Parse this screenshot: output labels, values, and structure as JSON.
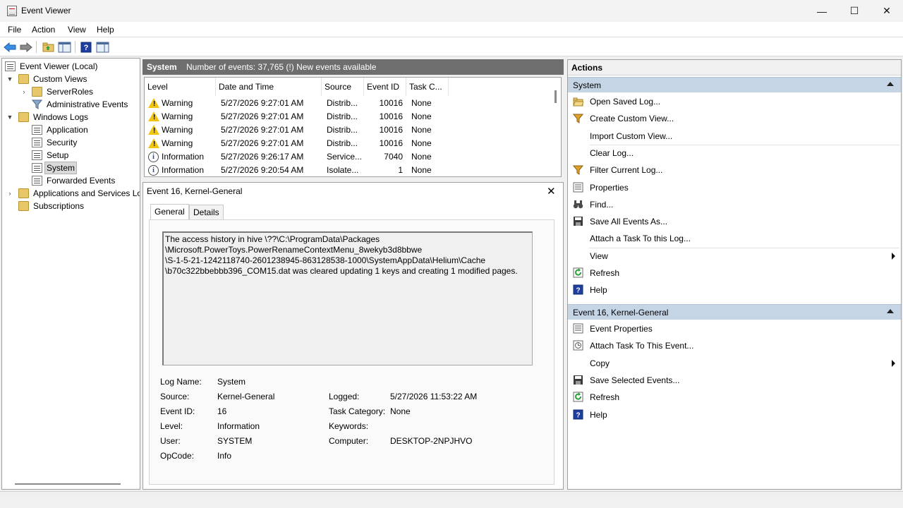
{
  "window": {
    "title": "Event Viewer",
    "minimize": "—",
    "maximize": "☐",
    "close": "✕"
  },
  "menu": [
    "File",
    "Action",
    "View",
    "Help"
  ],
  "tree": {
    "root": "Event Viewer (Local)",
    "custom_views": "Custom Views",
    "server_roles": "ServerRoles",
    "admin_events": "Administrative Events",
    "windows_logs": "Windows Logs",
    "application": "Application",
    "security": "Security",
    "setup": "Setup",
    "system": "System",
    "forwarded": "Forwarded Events",
    "apps_services": "Applications and Services Logs",
    "subscriptions": "Subscriptions"
  },
  "log_header": {
    "name": "System",
    "info": "Number of events: 37,765 (!) New events available"
  },
  "events": {
    "columns": [
      "Level",
      "Date and Time",
      "Source",
      "Event ID",
      "Task C..."
    ],
    "rows": [
      {
        "level": "Warning",
        "type": "warning",
        "datetime": "5/27/2026 9:27:01 AM",
        "source": "Distrib...",
        "id": "10016",
        "task": "None"
      },
      {
        "level": "Warning",
        "type": "warning",
        "datetime": "5/27/2026 9:27:01 AM",
        "source": "Distrib...",
        "id": "10016",
        "task": "None"
      },
      {
        "level": "Warning",
        "type": "warning",
        "datetime": "5/27/2026 9:27:01 AM",
        "source": "Distrib...",
        "id": "10016",
        "task": "None"
      },
      {
        "level": "Warning",
        "type": "warning",
        "datetime": "5/27/2026 9:27:01 AM",
        "source": "Distrib...",
        "id": "10016",
        "task": "None"
      },
      {
        "level": "Information",
        "type": "info",
        "datetime": "5/27/2026 9:26:17 AM",
        "source": "Service...",
        "id": "7040",
        "task": "None"
      },
      {
        "level": "Information",
        "type": "info",
        "datetime": "5/27/2026 9:20:54 AM",
        "source": "Isolate...",
        "id": "1",
        "task": "None"
      }
    ]
  },
  "detail": {
    "title": "Event 16, Kernel-General",
    "close": "✕",
    "tabs": {
      "general": "General",
      "details": "Details"
    },
    "description": [
      "The access history in hive \\??\\C:\\ProgramData\\Packages",
      "\\Microsoft.PowerToys.PowerRenameContextMenu_8wekyb3d8bbwe",
      "\\S-1-5-21-1242118740-2601238945-863128538-1000\\SystemAppData\\Helium\\Cache",
      "\\b70c322bbebbb396_COM15.dat was cleared updating 1 keys and creating 1 modified pages."
    ],
    "labels": {
      "log_name": "Log Name:",
      "source": "Source:",
      "event_id": "Event ID:",
      "level": "Level:",
      "user": "User:",
      "opcode": "OpCode:",
      "logged": "Logged:",
      "task_category": "Task Category:",
      "keywords": "Keywords:",
      "computer": "Computer:"
    },
    "values": {
      "log_name": "System",
      "source": "Kernel-General",
      "event_id": "16",
      "level": "Information",
      "user": "SYSTEM",
      "opcode": "Info",
      "logged": "5/27/2026 11:53:22 AM",
      "task_category": "None",
      "keywords": "",
      "computer": "DESKTOP-2NPJHVO"
    }
  },
  "actions": {
    "title": "Actions",
    "system_section": "System",
    "system_items": [
      {
        "label": "Open Saved Log...",
        "icon": "folder-open-icon"
      },
      {
        "label": "Create Custom View...",
        "icon": "filter-icon"
      },
      {
        "label": "Import Custom View...",
        "icon": ""
      },
      {
        "label": "Clear Log...",
        "icon": ""
      },
      {
        "label": "Filter Current Log...",
        "icon": "filter-icon"
      },
      {
        "label": "Properties",
        "icon": "properties-icon"
      },
      {
        "label": "Find...",
        "icon": "binoculars-icon"
      },
      {
        "label": "Save All Events As...",
        "icon": "save-icon"
      },
      {
        "label": "Attach a Task To this Log...",
        "icon": ""
      },
      {
        "label": "View",
        "icon": ""
      },
      {
        "label": "Refresh",
        "icon": "refresh-icon"
      },
      {
        "label": "Help",
        "icon": "help-icon"
      }
    ],
    "event_section": "Event 16, Kernel-General",
    "event_items": [
      {
        "label": "Event Properties",
        "icon": "properties-icon"
      },
      {
        "label": "Attach Task To This Event...",
        "icon": "task-icon"
      },
      {
        "label": "Copy",
        "icon": ""
      },
      {
        "label": "Save Selected Events...",
        "icon": "save-icon"
      },
      {
        "label": "Refresh",
        "icon": "refresh-icon"
      },
      {
        "label": "Help",
        "icon": "help-icon"
      }
    ]
  },
  "colors": {
    "header_gray": "#6e6e6e",
    "section_blue": "#c6d5e6",
    "warning_yellow": "#f1c40f",
    "help_blue": "#1f3f9f",
    "refresh_green": "#2e9d3a"
  }
}
